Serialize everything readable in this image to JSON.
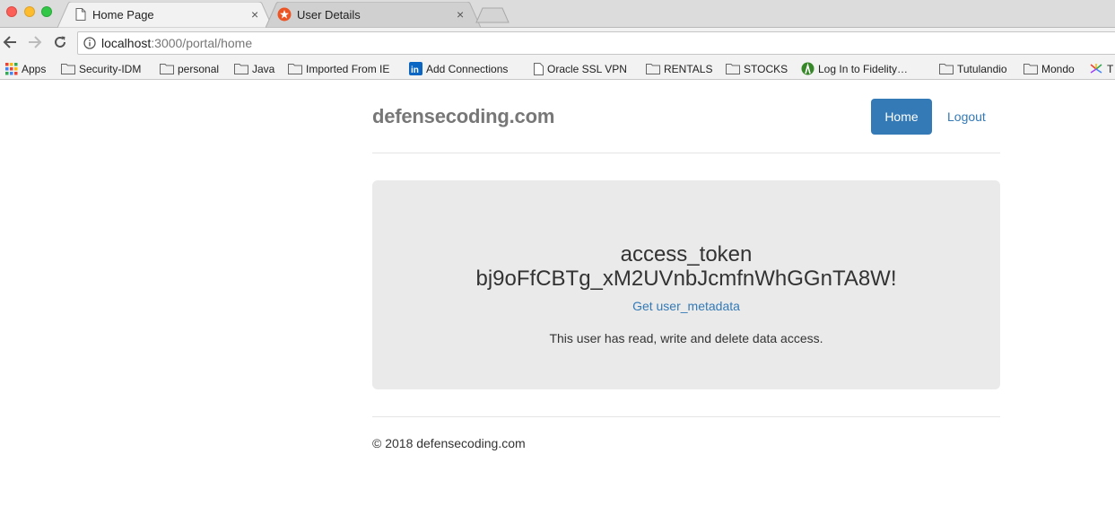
{
  "browser": {
    "tabs": [
      {
        "title": "Home Page",
        "icon": "page-icon",
        "active": true
      },
      {
        "title": "User Details",
        "icon": "auth0-icon",
        "active": false
      }
    ],
    "close_glyph": "×",
    "url": {
      "host": "localhost",
      "rest": ":3000/portal/home"
    }
  },
  "bookmarks": [
    {
      "label": "Apps",
      "icon": "apps-grid-icon"
    },
    {
      "label": "Security-IDM",
      "icon": "folder-icon"
    },
    {
      "label": "personal",
      "icon": "folder-icon"
    },
    {
      "label": "Java",
      "icon": "folder-icon"
    },
    {
      "label": "Imported From IE",
      "icon": "folder-icon"
    },
    {
      "label": "Add Connections",
      "icon": "linkedin-icon"
    },
    {
      "label": "Oracle SSL VPN",
      "icon": "page-icon"
    },
    {
      "label": "RENTALS",
      "icon": "folder-icon"
    },
    {
      "label": "STOCKS",
      "icon": "folder-icon"
    },
    {
      "label": "Log In to Fidelity…",
      "icon": "fidelity-icon"
    },
    {
      "label": "Tutulandio",
      "icon": "folder-icon"
    },
    {
      "label": "Mondo",
      "icon": "folder-icon"
    },
    {
      "label": "T",
      "icon": "colorful-icon"
    }
  ],
  "header": {
    "brand": "defensecoding.com",
    "home_label": "Home",
    "logout_label": "Logout"
  },
  "jumbotron": {
    "title": "access_token",
    "token": "bj9oFfCBTg_xM2UVnbJcmfnWhGGnTA8W!",
    "link": "Get user_metadata",
    "access_text": "This user has read, write and delete data access."
  },
  "footer": {
    "text": "© 2018 defensecoding.com"
  },
  "colors": {
    "primary": "#337ab7",
    "jumbotron_bg": "#eaeaea",
    "brand_text": "#777777"
  }
}
